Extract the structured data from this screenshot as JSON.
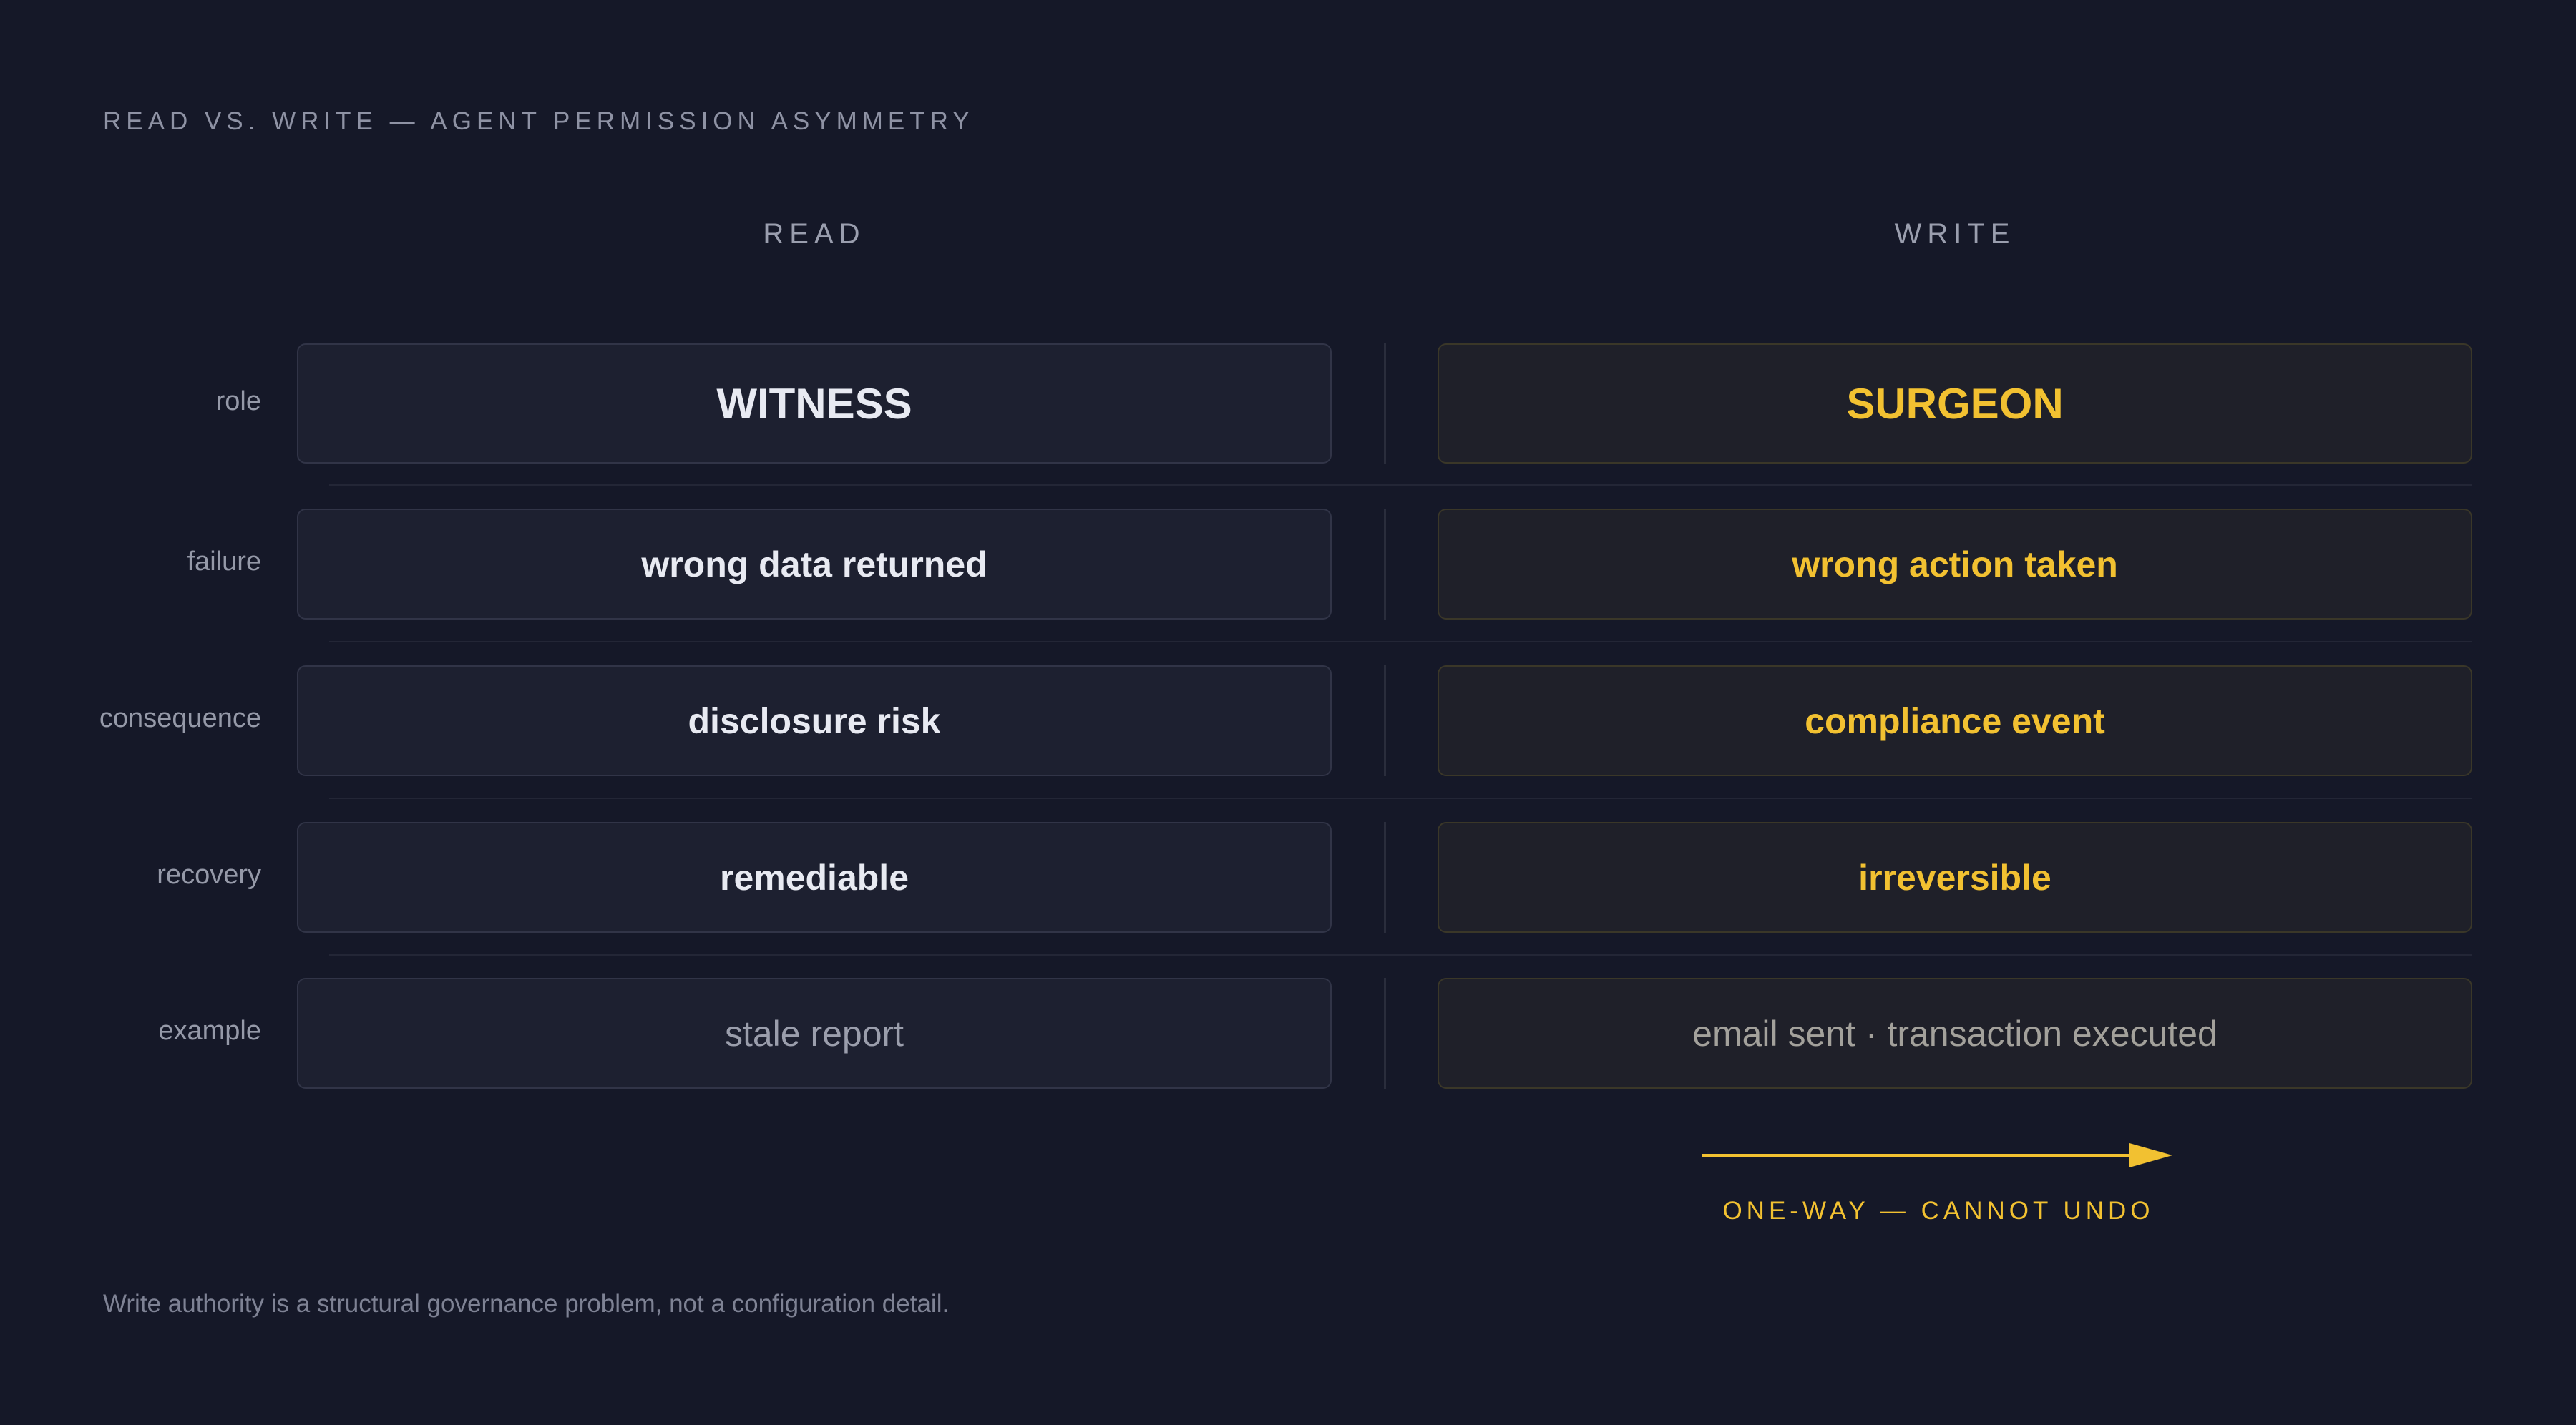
{
  "title": "READ VS. WRITE — AGENT PERMISSION ASYMMETRY",
  "columns": {
    "read": "READ",
    "write": "WRITE"
  },
  "rows": [
    {
      "label": "role",
      "read": "WITNESS",
      "write": "SURGEON"
    },
    {
      "label": "failure",
      "read": "wrong data returned",
      "write": "wrong action taken"
    },
    {
      "label": "consequence",
      "read": "disclosure risk",
      "write": "compliance event"
    },
    {
      "label": "recovery",
      "read": "remediable",
      "write": "irreversible"
    },
    {
      "label": "example",
      "read": "stale report",
      "write": "email sent · transaction executed"
    }
  ],
  "arrow_label": "ONE-WAY — CANNOT UNDO",
  "footnote": "Write authority is a structural governance problem, not a configuration detail.",
  "colors": {
    "background": "#151828",
    "accent": "#f2c131",
    "read_text": "#e8eaf2"
  },
  "icons": {
    "arrow": "right-arrow-icon"
  }
}
